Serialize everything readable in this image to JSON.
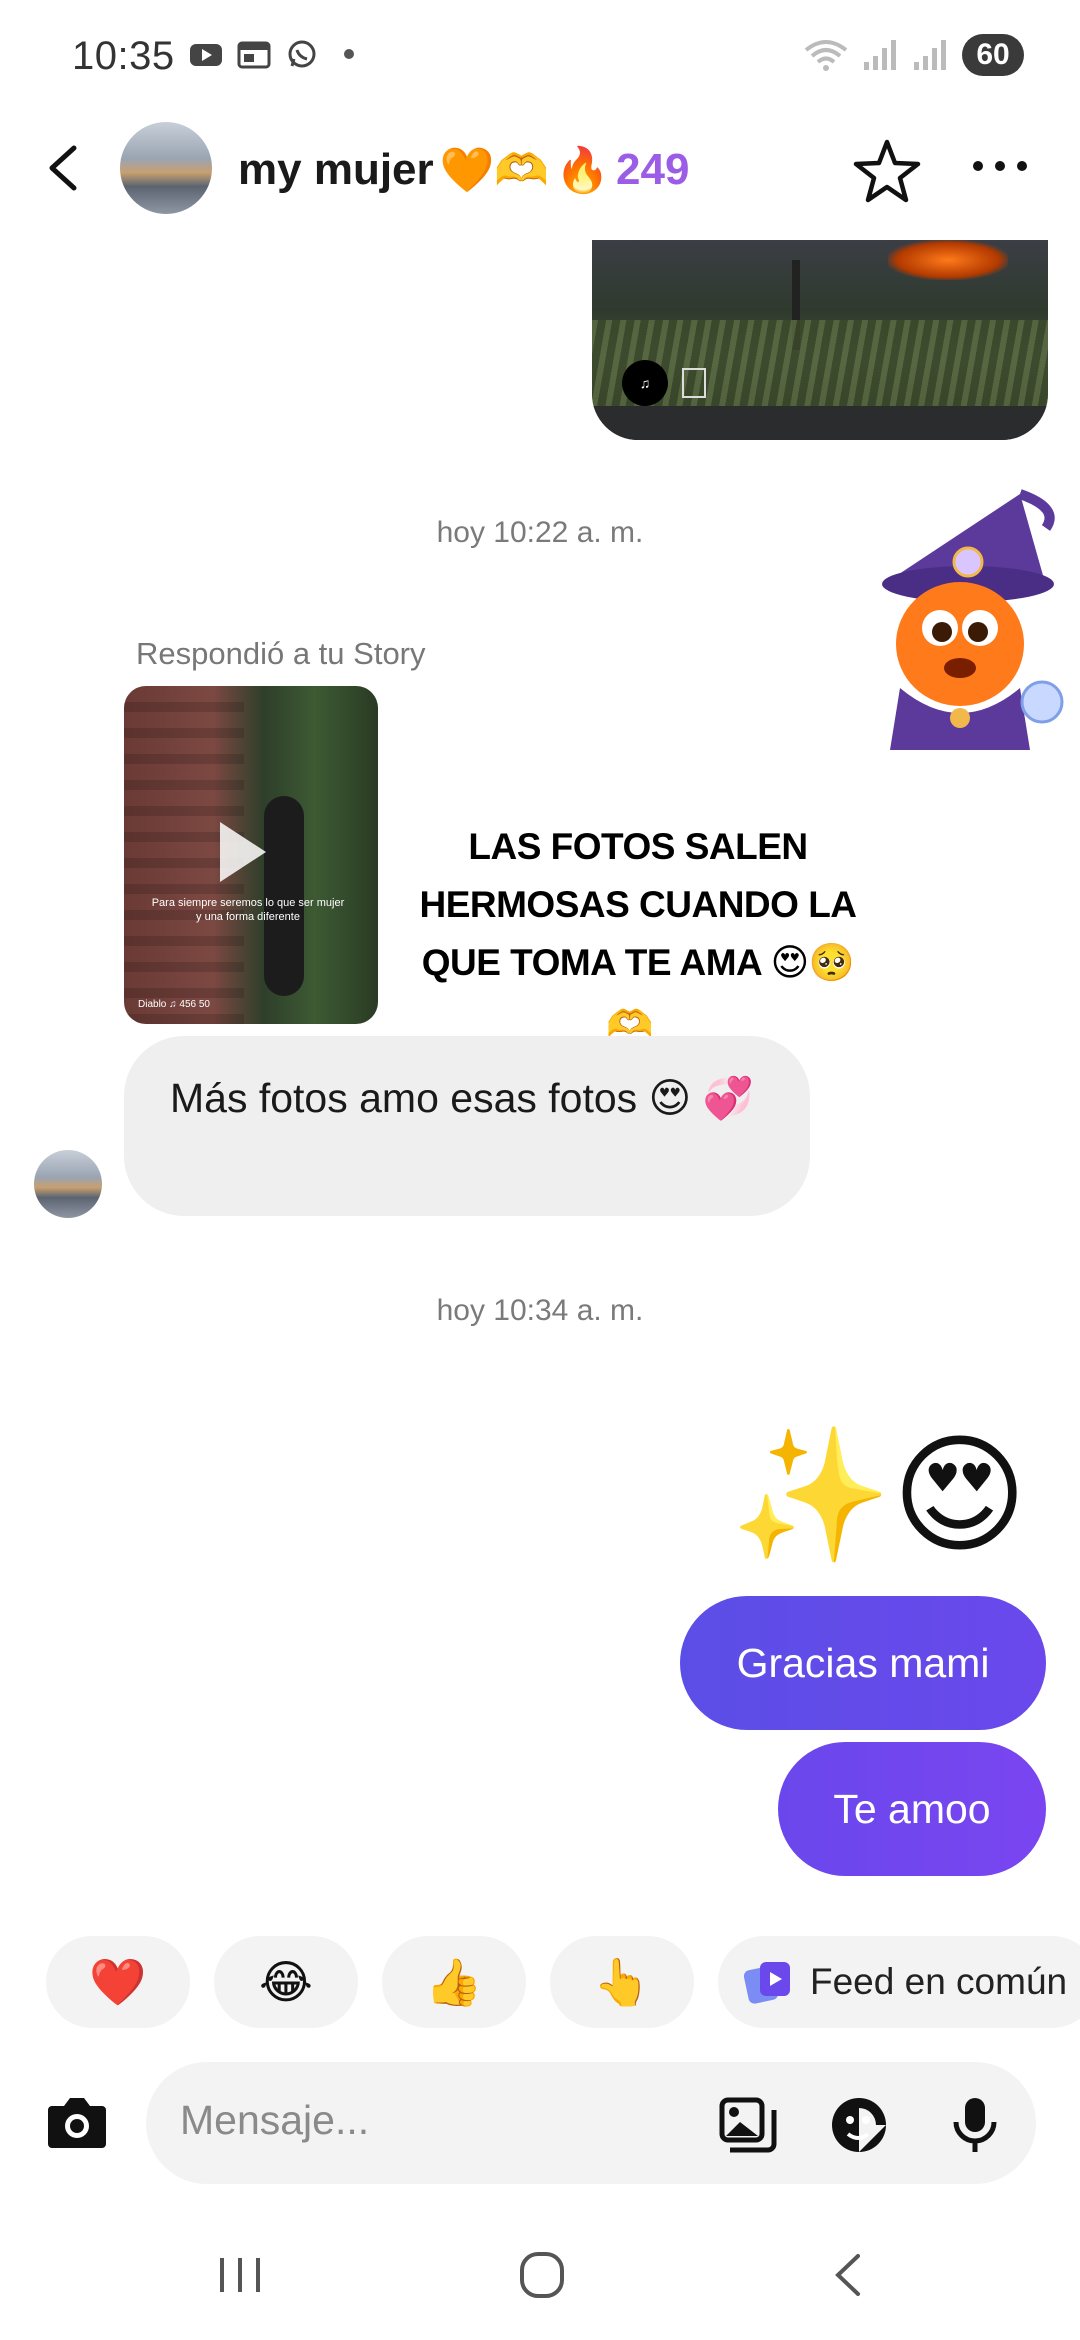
{
  "status_bar": {
    "time": "10:35",
    "battery": "60"
  },
  "header": {
    "contact_name": "my mujer",
    "name_emojis": "🧡🫶",
    "streak_icon": "🔥",
    "streak_count": "249",
    "accent_color": "#9b5de5"
  },
  "messages": {
    "timestamp_1": "hoy 10:22 a. m.",
    "replied_label": "Respondió a tu Story",
    "story": {
      "caption": "Para siempre seremos lo que ser mujer y una forma diferente",
      "meta": "Diablo ♫ 456 50",
      "text": "LAS FOTOS SALEN HERMOSAS CUANDO LA QUE TOMA TE AMA 😍🥺",
      "text_emoji_tail": "🫶"
    },
    "incoming_text": "Más fotos amo esas fotos 😍 💞",
    "timestamp_2": "hoy 10:34 a. m.",
    "big_emoji": "✨😍",
    "outgoing": [
      "Gracias mami",
      "Te amoo"
    ],
    "bubble_color": "#5b4ee6"
  },
  "quick_reactions": {
    "items": [
      "❤️",
      "😂",
      "👍",
      "👆"
    ],
    "feed_label": "Feed en común"
  },
  "composer": {
    "placeholder": "Mensaje..."
  }
}
